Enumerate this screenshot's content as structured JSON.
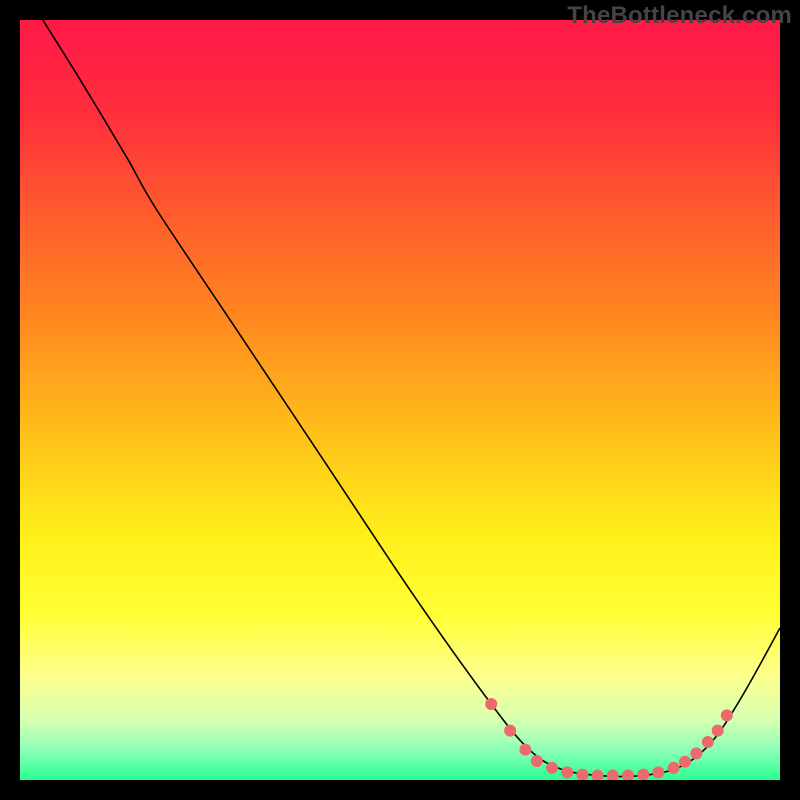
{
  "watermark": "TheBottleneck.com",
  "chart_data": {
    "type": "line",
    "title": "",
    "xlabel": "",
    "ylabel": "",
    "xlim": [
      0,
      100
    ],
    "ylim": [
      0,
      100
    ],
    "grid": false,
    "background_gradient": {
      "stops": [
        {
          "offset": 0.0,
          "color": "#ff1947"
        },
        {
          "offset": 0.12,
          "color": "#ff2d3d"
        },
        {
          "offset": 0.25,
          "color": "#ff5a2d"
        },
        {
          "offset": 0.4,
          "color": "#ff8a1e"
        },
        {
          "offset": 0.55,
          "color": "#ffc21a"
        },
        {
          "offset": 0.68,
          "color": "#fff01a"
        },
        {
          "offset": 0.78,
          "color": "#ffff33"
        },
        {
          "offset": 0.86,
          "color": "#feff8a"
        },
        {
          "offset": 0.92,
          "color": "#d9ffb0"
        },
        {
          "offset": 0.96,
          "color": "#8dffb8"
        },
        {
          "offset": 1.0,
          "color": "#2bff94"
        }
      ]
    },
    "series": [
      {
        "name": "curve",
        "color": "#000000",
        "width": 1.6,
        "points": [
          {
            "x": 3,
            "y": 100
          },
          {
            "x": 8,
            "y": 92
          },
          {
            "x": 14,
            "y": 82
          },
          {
            "x": 18,
            "y": 75
          },
          {
            "x": 28,
            "y": 60
          },
          {
            "x": 40,
            "y": 42
          },
          {
            "x": 52,
            "y": 24
          },
          {
            "x": 62,
            "y": 10
          },
          {
            "x": 67,
            "y": 4
          },
          {
            "x": 71,
            "y": 1.5
          },
          {
            "x": 76,
            "y": 0.6
          },
          {
            "x": 82,
            "y": 0.6
          },
          {
            "x": 87,
            "y": 1.8
          },
          {
            "x": 91,
            "y": 5
          },
          {
            "x": 95,
            "y": 11
          },
          {
            "x": 100,
            "y": 20
          }
        ]
      }
    ],
    "markers": {
      "name": "highlight-points",
      "color": "#ec6a6a",
      "radius": 6,
      "points": [
        {
          "x": 62,
          "y": 10
        },
        {
          "x": 64.5,
          "y": 6.5
        },
        {
          "x": 66.5,
          "y": 4
        },
        {
          "x": 68,
          "y": 2.5
        },
        {
          "x": 70,
          "y": 1.6
        },
        {
          "x": 72,
          "y": 1.0
        },
        {
          "x": 74,
          "y": 0.7
        },
        {
          "x": 76,
          "y": 0.6
        },
        {
          "x": 78,
          "y": 0.6
        },
        {
          "x": 80,
          "y": 0.6
        },
        {
          "x": 82,
          "y": 0.7
        },
        {
          "x": 84,
          "y": 1.0
        },
        {
          "x": 86,
          "y": 1.6
        },
        {
          "x": 87.5,
          "y": 2.4
        },
        {
          "x": 89,
          "y": 3.5
        },
        {
          "x": 90.5,
          "y": 5
        },
        {
          "x": 91.8,
          "y": 6.5
        },
        {
          "x": 93,
          "y": 8.5
        }
      ]
    }
  }
}
